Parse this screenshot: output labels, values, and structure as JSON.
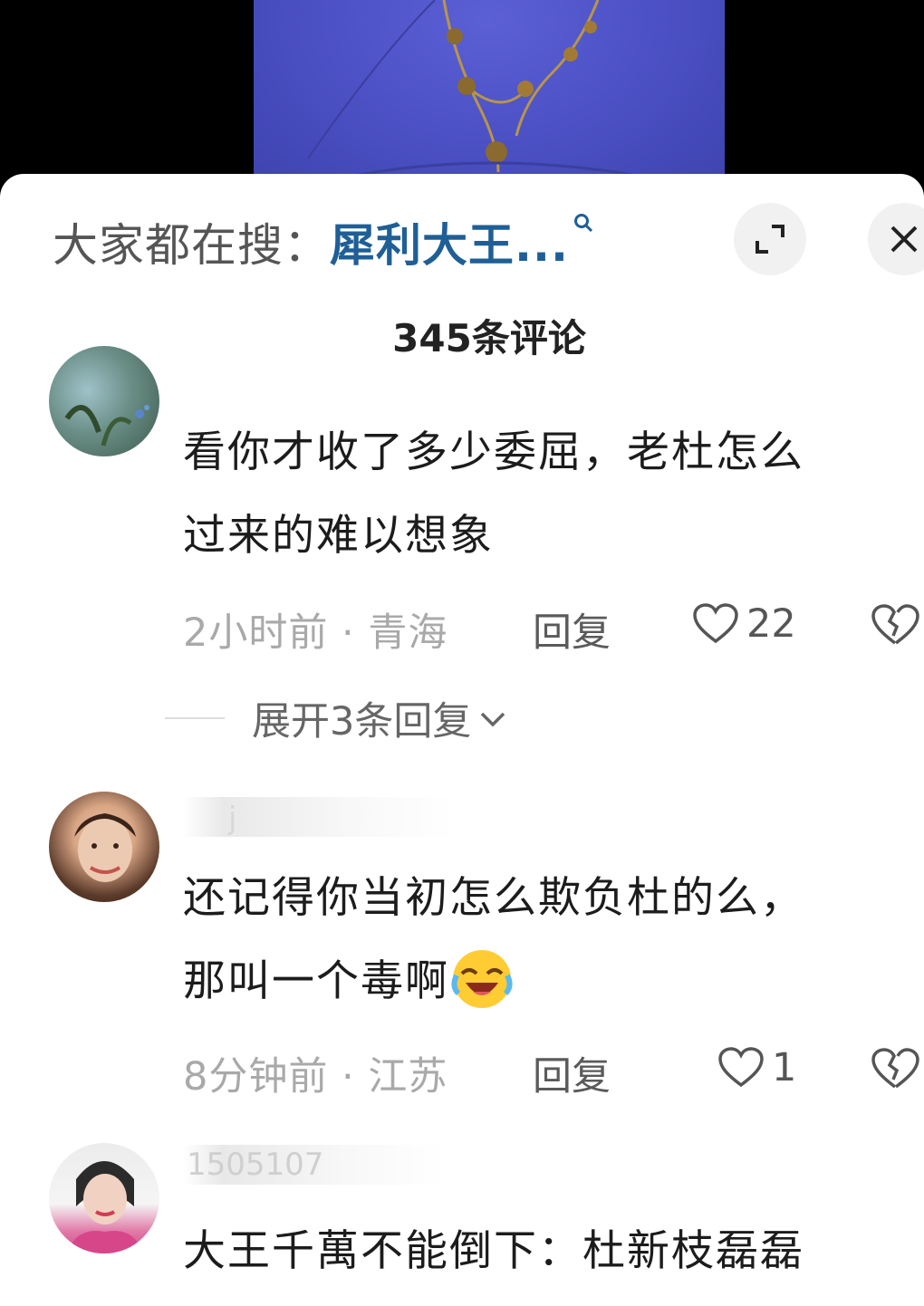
{
  "header": {
    "search_prefix": "大家都在搜：",
    "search_term": "犀利大王...",
    "comment_count": "345条评论"
  },
  "comments": [
    {
      "text_line1": "看你才收了多少委屈，老杜怎么",
      "text_line2": "过来的难以想象",
      "time": "2小时前",
      "location": "青海",
      "reply_label": "回复",
      "likes": "22",
      "expand_label": "展开3条回复"
    },
    {
      "username": "j",
      "text_line1": "还记得你当初怎么欺负杜的么，",
      "text_line2": "那叫一个毒啊",
      "time": "8分钟前",
      "location": "江苏",
      "reply_label": "回复",
      "likes": "1"
    },
    {
      "username": "1505107",
      "text_line1": "大王千萬不能倒下：杜新枝磊磊"
    }
  ],
  "colors": {
    "accent": "#1f5f96",
    "video_shirt": "#4d52c6"
  },
  "icons": [
    "search-icon",
    "expand-icon",
    "close-icon",
    "heart-icon",
    "broken-heart-icon",
    "chevron-down-icon",
    "laughing-crying-emoji"
  ]
}
